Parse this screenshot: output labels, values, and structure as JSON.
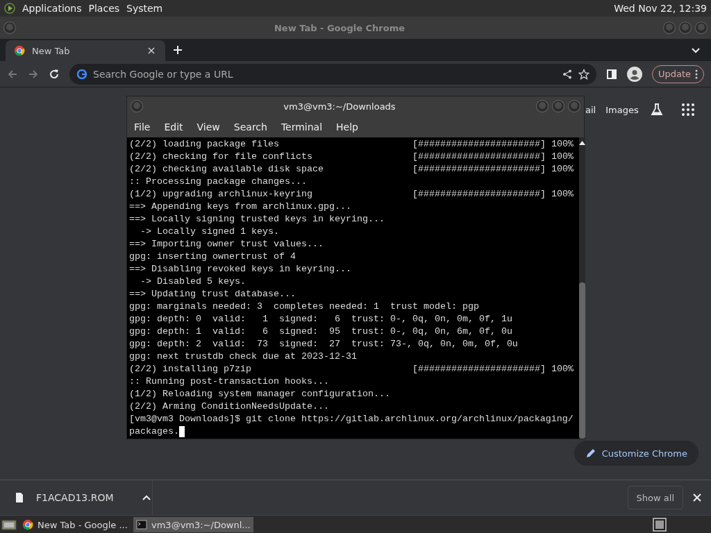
{
  "top_panel": {
    "menus": [
      "Applications",
      "Places",
      "System"
    ],
    "clock": "Wed Nov 22, 12:39"
  },
  "chrome": {
    "title": "New Tab - Google Chrome",
    "tabs": [
      {
        "label": "New Tab",
        "selected": true
      }
    ],
    "omnibox": {
      "placeholder": "Search Google or type a URL"
    },
    "update_button": "Update",
    "page_links": [
      "ail",
      "Images"
    ],
    "customize_button": "Customize Chrome"
  },
  "terminal": {
    "title": "vm3@vm3:~/Downloads",
    "menus": [
      "File",
      "Edit",
      "View",
      "Search",
      "Terminal",
      "Help"
    ],
    "lines": [
      {
        "text": "(2/2) loading package files",
        "bar": "[######################]",
        "percent": "100%"
      },
      {
        "text": "(2/2) checking for file conflicts",
        "bar": "[######################]",
        "percent": "100%"
      },
      {
        "text": "(2/2) checking available disk space",
        "bar": "[######################]",
        "percent": "100%"
      },
      {
        "text": ":: Processing package changes..."
      },
      {
        "text": "(1/2) upgrading archlinux-keyring",
        "bar": "[######################]",
        "percent": "100%"
      },
      {
        "text": "==> Appending keys from archlinux.gpg..."
      },
      {
        "text": "==> Locally signing trusted keys in keyring..."
      },
      {
        "text": "  -> Locally signed 1 keys."
      },
      {
        "text": "==> Importing owner trust values..."
      },
      {
        "text": "gpg: inserting ownertrust of 4"
      },
      {
        "text": "==> Disabling revoked keys in keyring..."
      },
      {
        "text": "  -> Disabled 5 keys."
      },
      {
        "text": "==> Updating trust database..."
      },
      {
        "text": "gpg: marginals needed: 3  completes needed: 1  trust model: pgp"
      },
      {
        "text": "gpg: depth: 0  valid:   1  signed:   6  trust: 0-, 0q, 0n, 0m, 0f, 1u"
      },
      {
        "text": "gpg: depth: 1  valid:   6  signed:  95  trust: 0-, 0q, 0n, 6m, 0f, 0u"
      },
      {
        "text": "gpg: depth: 2  valid:  73  signed:  27  trust: 73-, 0q, 0n, 0m, 0f, 0u"
      },
      {
        "text": "gpg: next trustdb check due at 2023-12-31"
      },
      {
        "text": "(2/2) installing p7zip",
        "bar": "[######################]",
        "percent": "100%"
      },
      {
        "text": ":: Running post-transaction hooks..."
      },
      {
        "text": "(1/2) Reloading system manager configuration..."
      },
      {
        "text": "(2/2) Arming ConditionNeedsUpdate..."
      },
      {
        "text": "[vm3@vm3 Downloads]$ git clone https://gitlab.archlinux.org/archlinux/packaging/"
      },
      {
        "text": "packages.",
        "cursor": true
      }
    ]
  },
  "download_bar": {
    "file": "F1ACAD13.ROM",
    "show_all": "Show all"
  },
  "taskbar": {
    "items": [
      {
        "label": "New Tab - Google ...",
        "kind": "chrome",
        "selected": false
      },
      {
        "label": "vm3@vm3:~/Downl...",
        "kind": "terminal",
        "selected": true
      }
    ]
  }
}
